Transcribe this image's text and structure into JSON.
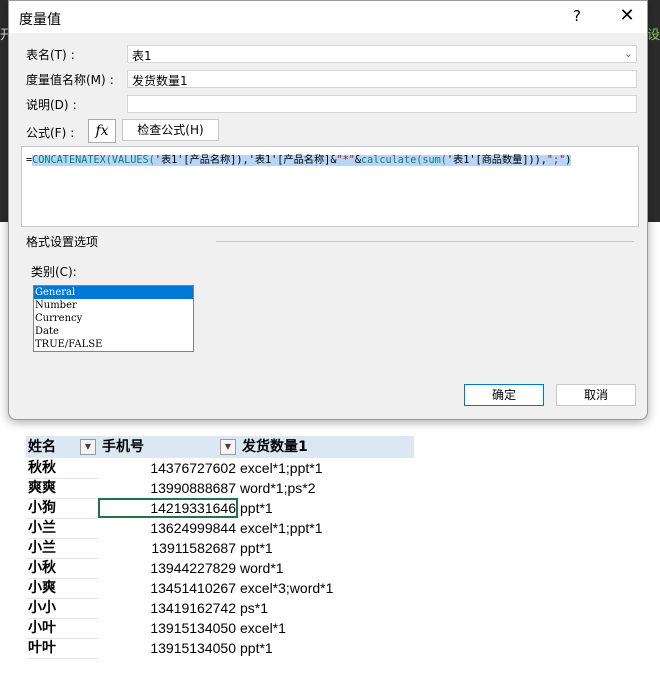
{
  "background": {
    "left_char": "开",
    "right_char": "设"
  },
  "dialog": {
    "title": "度量值",
    "help": "?",
    "close": "✕",
    "table_label": "表名(T)",
    "table_value": "表1",
    "measure_label": "度量值名称(M)",
    "measure_value": "发货数量1",
    "desc_label": "说明(D)",
    "desc_value": "",
    "formula_label": "公式(F)",
    "fx": "fx",
    "check_formula": "检查公式(H)",
    "formula": {
      "eq": "=",
      "fn1": "CONCATENATEX(VALUES(",
      "s1": "'表1'[产品名称]",
      "t1": "),",
      "s2": "'表1'[产品名称]",
      "t2": "&",
      "s3": "\"*\"",
      "t3": "&",
      "fn2": "calculate(sum(",
      "s4": "'表1'[商品数量]",
      "t4": ")),",
      "s5": "\";\"",
      "t5": ")"
    },
    "format_section": "格式设置选项",
    "category_label": "类别(C):",
    "categories": [
      "General",
      "Number",
      "Currency",
      "Date",
      "TRUE/FALSE"
    ],
    "selected_category": "General",
    "ok": "确定",
    "cancel": "取消"
  },
  "sheet": {
    "headers": [
      "姓名",
      "手机号",
      "发货数量1"
    ],
    "rows": [
      {
        "name": "秋秋",
        "phone": "14376727602",
        "qty": "excel*1;ppt*1"
      },
      {
        "name": "爽爽",
        "phone": "13990888687",
        "qty": "word*1;ps*2"
      },
      {
        "name": "小狗",
        "phone": "14219331646",
        "qty": "ppt*1"
      },
      {
        "name": "小兰",
        "phone": "13624999844",
        "qty": "excel*1;ppt*1"
      },
      {
        "name": "小兰",
        "phone": "13911582687",
        "qty": "ppt*1"
      },
      {
        "name": "小秋",
        "phone": "13944227829",
        "qty": "word*1"
      },
      {
        "name": "小爽",
        "phone": "13451410267",
        "qty": "excel*3;word*1"
      },
      {
        "name": "小小",
        "phone": "13419162742",
        "qty": "ps*1"
      },
      {
        "name": "小叶",
        "phone": "13915134050",
        "qty": "excel*1"
      },
      {
        "name": "叶叶",
        "phone": "13915134050",
        "qty": "ppt*1"
      }
    ]
  }
}
